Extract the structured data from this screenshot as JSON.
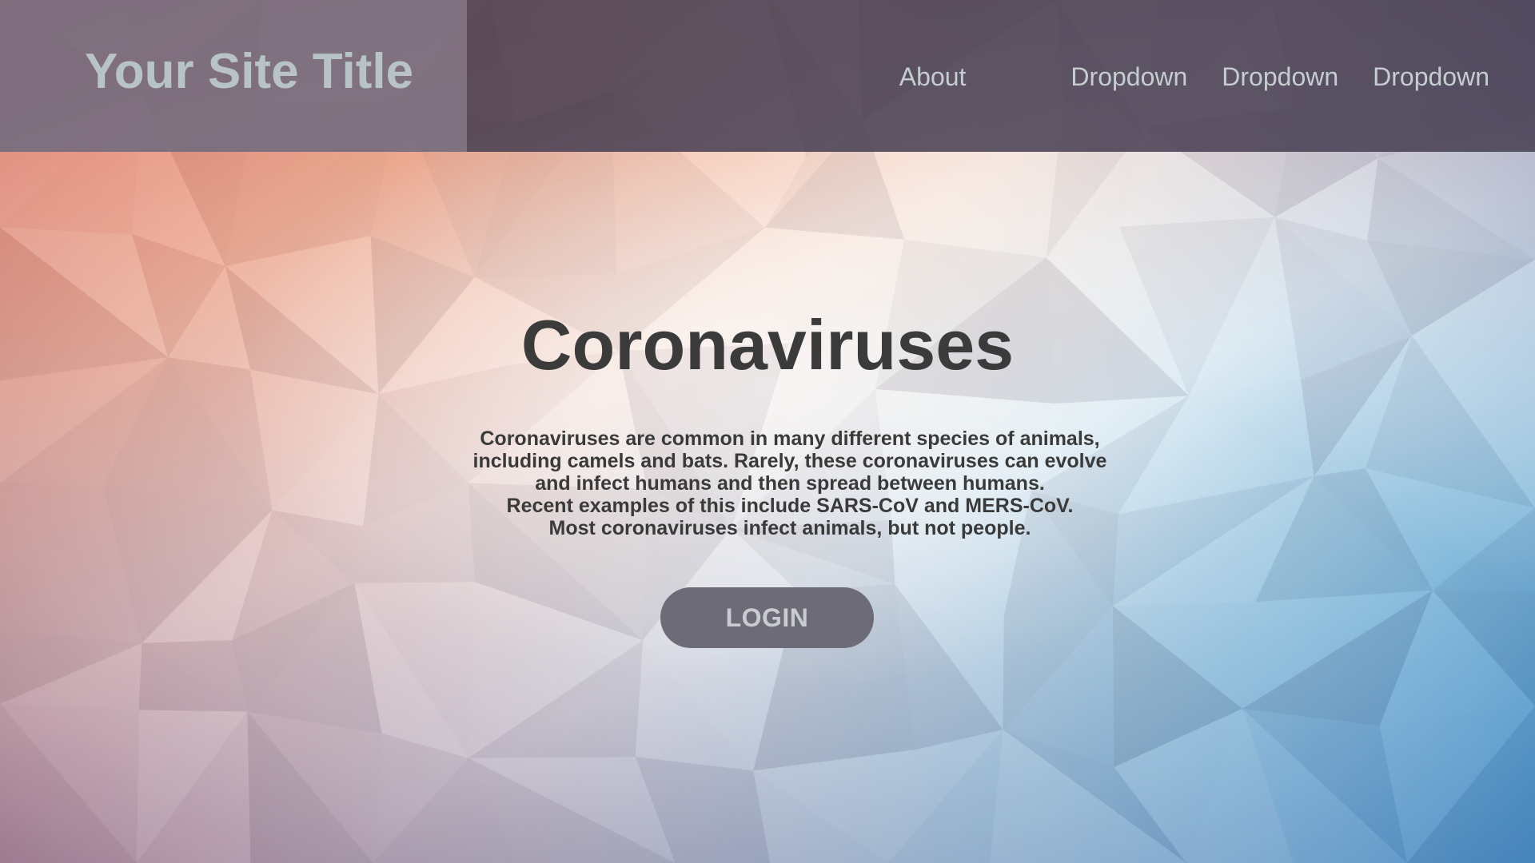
{
  "header": {
    "site_title": "Your Site Title",
    "nav": {
      "about": "About",
      "dropdowns": [
        "Dropdown",
        "Dropdown",
        "Dropdown"
      ]
    }
  },
  "hero": {
    "title": "Coronaviruses",
    "description_lines": [
      "Coronaviruses are common in many different species of animals,",
      "including camels and bats. Rarely, these coronaviruses can evolve",
      "and infect humans and then spread between humans.",
      "Recent examples of this include SARS-CoV and MERS-CoV.",
      "Most coronaviruses infect animals, but not people."
    ],
    "login_label": "LOGIN"
  },
  "colors": {
    "header_overlay": "#463e52",
    "title_text": "#b7c3c4",
    "nav_text": "#c6cdd0",
    "hero_text": "#3b3b3b",
    "button_bg": "#6e6b78",
    "button_text": "#c8ccd0",
    "bg_top_left": "#d9644f",
    "bg_center": "#f4ece6",
    "bg_bottom_right": "#2f7fc0"
  }
}
